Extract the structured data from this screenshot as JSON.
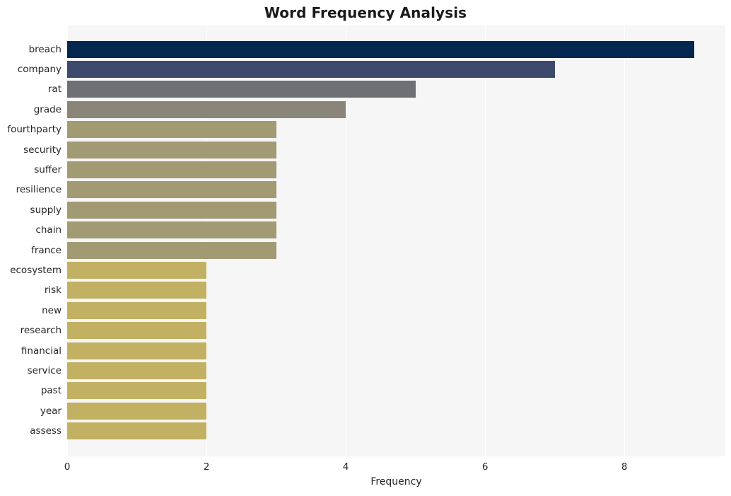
{
  "chart_data": {
    "type": "bar",
    "orientation": "horizontal",
    "title": "Word Frequency Analysis",
    "xlabel": "Frequency",
    "ylabel": "",
    "categories": [
      "breach",
      "company",
      "rat",
      "grade",
      "fourthparty",
      "security",
      "suffer",
      "resilience",
      "supply",
      "chain",
      "france",
      "ecosystem",
      "risk",
      "new",
      "research",
      "financial",
      "service",
      "past",
      "year",
      "assess"
    ],
    "values": [
      9,
      7,
      5,
      4,
      3,
      3,
      3,
      3,
      3,
      3,
      3,
      2,
      2,
      2,
      2,
      2,
      2,
      2,
      2,
      2
    ],
    "bar_colors": [
      "#04264f",
      "#3d4a6d",
      "#6e7074",
      "#898679",
      "#a29a73",
      "#a29a73",
      "#a29a73",
      "#a29a73",
      "#a29a73",
      "#a29a73",
      "#a29a73",
      "#c2b063",
      "#c2b063",
      "#c2b063",
      "#c2b063",
      "#c2b063",
      "#c2b063",
      "#c2b063",
      "#c2b063",
      "#c2b063"
    ],
    "xticks": [
      0,
      2,
      4,
      6,
      8
    ],
    "xtick_labels": [
      "0",
      "2",
      "4",
      "6",
      "8"
    ],
    "xlim": [
      0,
      9.45
    ],
    "grid": true,
    "grid_axis": "x",
    "legend": false,
    "plot_background": "#f6f6f6",
    "figure_background": "#ffffff",
    "title_color": "#1a1a1a",
    "tick_color": "#262626"
  }
}
